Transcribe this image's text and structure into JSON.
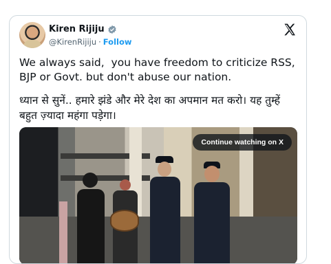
{
  "post": {
    "author_name": "Kiren Rijiju",
    "handle": "@KirenRijiju",
    "separator": "·",
    "follow_label": "Follow",
    "text_en": "We always said,  you have freedom to criticize RSS, BJP or Govt. but don't abuse our nation.",
    "text_hi": "ध्यान से सुनें.. हमारे झंडे और मेरे देश का अपमान मत करो। यह तुम्हें बहुत ज़्यादा महंगा पड़ेगा।"
  },
  "media": {
    "continue_label": "Continue watching on X",
    "description_icon": "video-thumbnail"
  },
  "icons": {
    "verified": "verified-badge-icon",
    "brand": "x-logo-icon"
  },
  "colors": {
    "accent": "#1d9bf0",
    "text": "#0f1419",
    "muted": "#536471",
    "border": "#cfd9de"
  }
}
